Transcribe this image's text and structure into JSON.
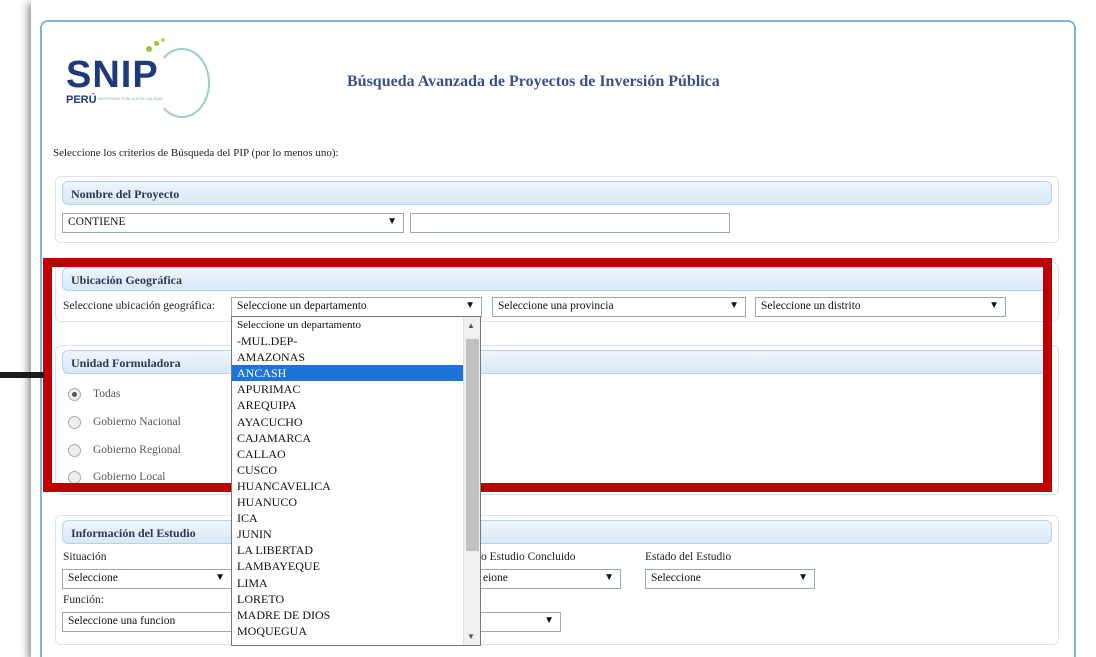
{
  "logo": {
    "text": "SNIP",
    "sub": "PERÚ",
    "tagline": "INVERSIÓN PÚBLICA DE CALIDAD"
  },
  "page_title": "Búsqueda Avanzada de Proyectos de Inversión Pública",
  "criteria_text": "Seleccione los criterios de Búsqueda del PIP (por lo menos uno):",
  "nombre": {
    "header": "Nombre del Proyecto",
    "match_select": "CONTIENE",
    "text_value": ""
  },
  "ubicacion": {
    "header": "Ubicación Geográfica",
    "label": "Seleccione ubicación geográfica:",
    "departamento": "Seleccione un departamento",
    "provincia": "Seleccione una provincia",
    "distrito": "Seleccione un distrito"
  },
  "dropdown_options": [
    "Seleccione un departamento",
    "-MUL.DEP-",
    "AMAZONAS",
    "ANCASH",
    "APURIMAC",
    "AREQUIPA",
    "AYACUCHO",
    "CAJAMARCA",
    "CALLAO",
    "CUSCO",
    "HUANCAVELICA",
    "HUANUCO",
    "ICA",
    "JUNIN",
    "LA LIBERTAD",
    "LAMBAYEQUE",
    "LIMA",
    "LORETO",
    "MADRE DE DIOS",
    "MOQUEGUA"
  ],
  "dropdown_selected": "ANCASH",
  "unidad": {
    "header": "Unidad Formuladora",
    "options": [
      "Todas",
      "Gobierno Nacional",
      "Gobierno Regional",
      "Gobierno Local"
    ],
    "selected": "Todas"
  },
  "estudio": {
    "header": "Información del Estudio",
    "situacion_label": "Situación",
    "situacion_value": "Seleccione",
    "concluido_label": "o Estudio Concluido",
    "concluido_value": "eione",
    "estado_label": "Estado del Estudio",
    "estado_value": "Seleccione",
    "funcion_label": "Función:",
    "funcion_value": "Seleccione una funcion"
  },
  "colors": {
    "highlight": "#c00000",
    "selected_option": "#1e74d9",
    "title": "#3b4f8a"
  }
}
